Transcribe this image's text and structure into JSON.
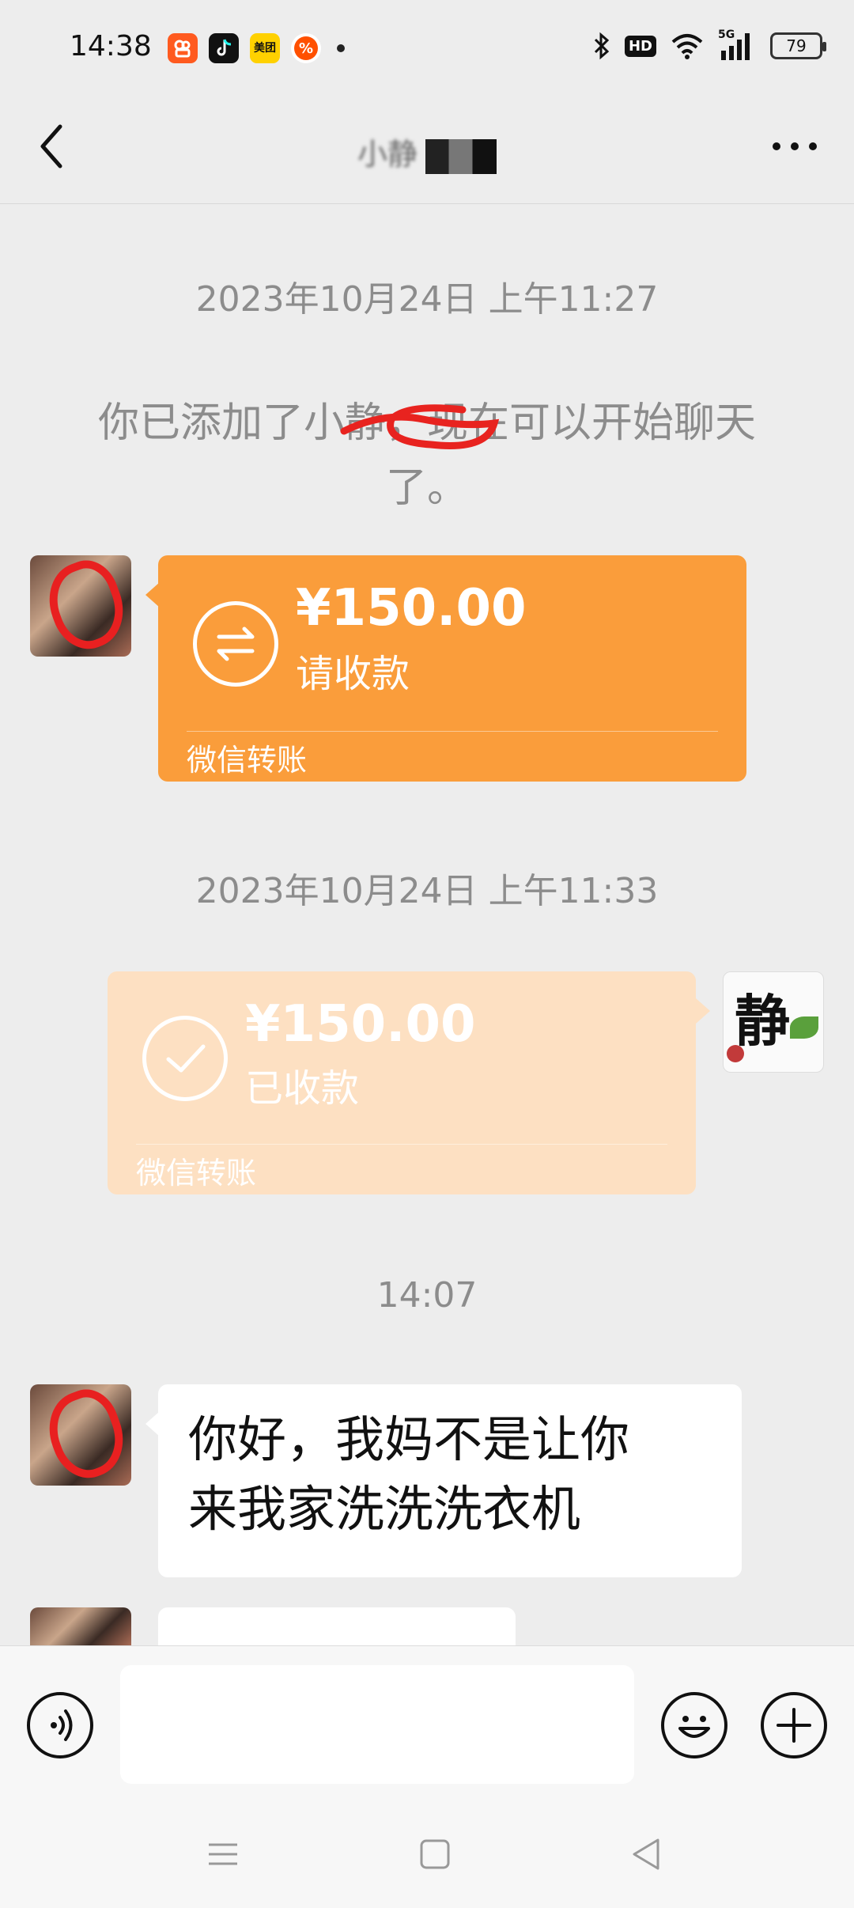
{
  "status_bar": {
    "time": "14:38",
    "apps": [
      {
        "name": "kuaishou-app-icon",
        "glyph": "&#8734;",
        "color": "#ff5a1f"
      },
      {
        "name": "douyin-app-icon",
        "glyph": "♪",
        "color": "#111111"
      },
      {
        "name": "meituan-app-icon",
        "glyph": "美团",
        "color": "#ffd100"
      },
      {
        "name": "taobao-app-icon",
        "glyph": "%",
        "color": "#ff5000"
      }
    ],
    "hd": "HD",
    "network": "5G",
    "battery": "79"
  },
  "header": {
    "title": "小静"
  },
  "messages": {
    "timestamp_1": "2023年10月24日 上午11:27",
    "system_notice": "你已添加了小静，现在可以开始聊天了。",
    "transfer_1": {
      "amount": "¥150.00",
      "status": "请收款",
      "label": "微信转账"
    },
    "timestamp_2": "2023年10月24日 上午11:33",
    "transfer_2": {
      "amount": "¥150.00",
      "status": "已收款",
      "label": "微信转账"
    },
    "timestamp_3": "14:07",
    "text_1_line_1": "你好，我妈不是让你",
    "text_1_line_2": "来我家洗洗洗衣机"
  },
  "avatar_me": {
    "glyph": "静"
  },
  "colors": {
    "transfer_pending": "#fa9d3b",
    "transfer_done": "#fde0c2",
    "background": "#ededed"
  }
}
